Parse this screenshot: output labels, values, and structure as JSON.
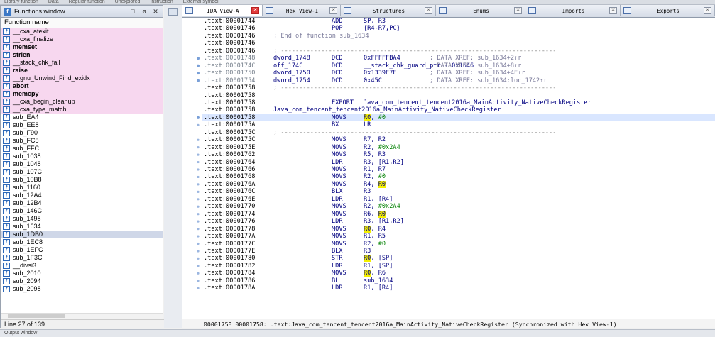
{
  "top_menu": [
    "Library function",
    "Data",
    "Regular function",
    "Unexplored",
    "Instruction",
    "External symbol"
  ],
  "functions_window": {
    "title": "Functions window",
    "column_header": "Function name",
    "status": "Line 27 of 139",
    "items": [
      {
        "name": "__cxa_atexit",
        "kind": "lib",
        "bold": false
      },
      {
        "name": "__cxa_finalize",
        "kind": "lib",
        "bold": false
      },
      {
        "name": "memset",
        "kind": "lib",
        "bold": true
      },
      {
        "name": "strlen",
        "kind": "lib",
        "bold": true
      },
      {
        "name": "__stack_chk_fail",
        "kind": "lib",
        "bold": false
      },
      {
        "name": "raise",
        "kind": "lib",
        "bold": true
      },
      {
        "name": "__gnu_Unwind_Find_exidx",
        "kind": "lib",
        "bold": false
      },
      {
        "name": "abort",
        "kind": "lib",
        "bold": true
      },
      {
        "name": "memcpy",
        "kind": "lib",
        "bold": true
      },
      {
        "name": "__cxa_begin_cleanup",
        "kind": "lib",
        "bold": false
      },
      {
        "name": "__cxa_type_match",
        "kind": "lib",
        "bold": false
      },
      {
        "name": "sub_EA4",
        "kind": "reg",
        "bold": false
      },
      {
        "name": "sub_EE8",
        "kind": "reg",
        "bold": false
      },
      {
        "name": "sub_F90",
        "kind": "reg",
        "bold": false
      },
      {
        "name": "sub_FC8",
        "kind": "reg",
        "bold": false
      },
      {
        "name": "sub_FFC",
        "kind": "reg",
        "bold": false
      },
      {
        "name": "sub_1038",
        "kind": "reg",
        "bold": false
      },
      {
        "name": "sub_1048",
        "kind": "reg",
        "bold": false
      },
      {
        "name": "sub_107C",
        "kind": "reg",
        "bold": false
      },
      {
        "name": "sub_10B8",
        "kind": "reg",
        "bold": false
      },
      {
        "name": "sub_1160",
        "kind": "reg",
        "bold": false
      },
      {
        "name": "sub_12A4",
        "kind": "reg",
        "bold": false
      },
      {
        "name": "sub_12B4",
        "kind": "reg",
        "bold": false
      },
      {
        "name": "sub_146C",
        "kind": "reg",
        "bold": false
      },
      {
        "name": "sub_1498",
        "kind": "reg",
        "bold": false
      },
      {
        "name": "sub_1634",
        "kind": "reg",
        "bold": false
      },
      {
        "name": "sub_1DB0",
        "kind": "sel",
        "bold": false
      },
      {
        "name": "sub_1EC8",
        "kind": "reg",
        "bold": false
      },
      {
        "name": "sub_1EFC",
        "kind": "reg",
        "bold": false
      },
      {
        "name": "sub_1F3C",
        "kind": "reg",
        "bold": false
      },
      {
        "name": "__divsi3",
        "kind": "reg",
        "bold": false
      },
      {
        "name": "sub_2010",
        "kind": "reg",
        "bold": false
      },
      {
        "name": "sub_2094",
        "kind": "reg",
        "bold": false
      },
      {
        "name": "sub_2098",
        "kind": "reg",
        "bold": false
      }
    ]
  },
  "tabs": [
    {
      "label": "IDA View-A",
      "active": true
    },
    {
      "label": "Hex View-1",
      "active": false
    },
    {
      "label": "Structures",
      "active": false
    },
    {
      "label": "Enums",
      "active": false
    },
    {
      "label": "Imports",
      "active": false
    },
    {
      "label": "Exports",
      "active": false
    }
  ],
  "disasm_lines": [
    {
      "addr": ".text:00001744",
      "label": "",
      "mn": "ADD",
      "op": "SP, R3",
      "cmt": "",
      "style": "code"
    },
    {
      "addr": ".text:00001746",
      "label": "",
      "mn": "POP",
      "op": "{R4-R7,PC}",
      "cmt": "",
      "style": "code"
    },
    {
      "addr": ".text:00001746",
      "label": "",
      "mn": "",
      "op": "",
      "cmt": "; End of function sub_1634",
      "style": "endfn"
    },
    {
      "addr": ".text:00001746",
      "label": "",
      "mn": "",
      "op": "",
      "cmt": "",
      "style": "code"
    },
    {
      "addr": ".text:00001746",
      "label": "",
      "mn": "",
      "op": "",
      "cmt": "",
      "style": "sep"
    },
    {
      "addr": ".text:00001748",
      "label": "dword_1748",
      "mn": "DCD",
      "op": "0xFFFFFBA4",
      "cmt": "; DATA XREF: sub_1634+2↑r",
      "style": "data"
    },
    {
      "addr": ".text:0000174C",
      "label": "off_174C",
      "mn": "DCD",
      "op": "__stack_chk_guard_ptr - 0x1646",
      "cmt": "; DATA XREF: sub_1634+8↑r",
      "style": "data"
    },
    {
      "addr": ".text:00001750",
      "label": "dword_1750",
      "mn": "DCD",
      "op": "0x1339E7E",
      "cmt": "; DATA XREF: sub_1634+4E↑r",
      "style": "data"
    },
    {
      "addr": ".text:00001754",
      "label": "dword_1754",
      "mn": "DCD",
      "op": "0x45C",
      "cmt": "; DATA XREF: sub_1634:loc_1742↑r",
      "style": "data"
    },
    {
      "addr": ".text:00001758",
      "label": "",
      "mn": "",
      "op": "",
      "cmt": "",
      "style": "sep"
    },
    {
      "addr": ".text:00001758",
      "label": "",
      "mn": "",
      "op": "",
      "cmt": "",
      "style": "code"
    },
    {
      "addr": ".text:00001758",
      "label": "",
      "mn": "EXPORT",
      "op": "Java_com_tencent_tencent2016a_MainActivity_NativeCheckRegister",
      "cmt": "",
      "style": "export"
    },
    {
      "addr": ".text:00001758",
      "label": "Java_com_tencent_tencent2016a_MainActivity_NativeCheckRegister",
      "mn": "",
      "op": "",
      "cmt": "",
      "style": "fnlabel"
    },
    {
      "addr": ".text:00001758",
      "label": "",
      "mn": "MOVS",
      "op": "R0, #0",
      "cmt": "",
      "style": "cur"
    },
    {
      "addr": ".text:0000175A",
      "label": "",
      "mn": "BX",
      "op": "LR",
      "cmt": "",
      "style": "code"
    },
    {
      "addr": ".text:0000175C",
      "label": "",
      "mn": "",
      "op": "",
      "cmt": "",
      "style": "sep"
    },
    {
      "addr": ".text:0000175C",
      "label": "",
      "mn": "MOVS",
      "op": "R7, R2",
      "cmt": "",
      "style": "code"
    },
    {
      "addr": ".text:0000175E",
      "label": "",
      "mn": "MOVS",
      "op": "R2, #0x2A4",
      "cmt": "",
      "style": "code"
    },
    {
      "addr": ".text:00001762",
      "label": "",
      "mn": "MOVS",
      "op": "R5, R3",
      "cmt": "",
      "style": "code"
    },
    {
      "addr": ".text:00001764",
      "label": "",
      "mn": "LDR",
      "op": "R3, [R1,R2]",
      "cmt": "",
      "style": "code"
    },
    {
      "addr": ".text:00001766",
      "label": "",
      "mn": "MOVS",
      "op": "R1, R7",
      "cmt": "",
      "style": "code"
    },
    {
      "addr": ".text:00001768",
      "label": "",
      "mn": "MOVS",
      "op": "R2, #0",
      "cmt": "",
      "style": "code"
    },
    {
      "addr": ".text:0000176A",
      "label": "",
      "mn": "MOVS",
      "op": "R4, R0",
      "cmt": "",
      "style": "code"
    },
    {
      "addr": ".text:0000176C",
      "label": "",
      "mn": "BLX",
      "op": "R3",
      "cmt": "",
      "style": "code"
    },
    {
      "addr": ".text:0000176E",
      "label": "",
      "mn": "LDR",
      "op": "R1, [R4]",
      "cmt": "",
      "style": "code"
    },
    {
      "addr": ".text:00001770",
      "label": "",
      "mn": "MOVS",
      "op": "R2, #0x2A4",
      "cmt": "",
      "style": "code"
    },
    {
      "addr": ".text:00001774",
      "label": "",
      "mn": "MOVS",
      "op": "R6, R0",
      "cmt": "",
      "style": "code"
    },
    {
      "addr": ".text:00001776",
      "label": "",
      "mn": "LDR",
      "op": "R3, [R1,R2]",
      "cmt": "",
      "style": "code"
    },
    {
      "addr": ".text:00001778",
      "label": "",
      "mn": "MOVS",
      "op": "R0, R4",
      "cmt": "",
      "style": "code"
    },
    {
      "addr": ".text:0000177A",
      "label": "",
      "mn": "MOVS",
      "op": "R1, R5",
      "cmt": "",
      "style": "code"
    },
    {
      "addr": ".text:0000177C",
      "label": "",
      "mn": "MOVS",
      "op": "R2, #0",
      "cmt": "",
      "style": "code"
    },
    {
      "addr": ".text:0000177E",
      "label": "",
      "mn": "BLX",
      "op": "R3",
      "cmt": "",
      "style": "code"
    },
    {
      "addr": ".text:00001780",
      "label": "",
      "mn": "STR",
      "op": "R0, [SP]",
      "cmt": "",
      "style": "code"
    },
    {
      "addr": ".text:00001782",
      "label": "",
      "mn": "LDR",
      "op": "R1, [SP]",
      "cmt": "",
      "style": "code"
    },
    {
      "addr": ".text:00001784",
      "label": "",
      "mn": "MOVS",
      "op": "R0, R6",
      "cmt": "",
      "style": "code"
    },
    {
      "addr": ".text:00001786",
      "label": "",
      "mn": "BL",
      "op": "sub_1634",
      "cmt": "",
      "style": "code"
    },
    {
      "addr": ".text:0000178A",
      "label": "",
      "mn": "LDR",
      "op": "R1, [R4]",
      "cmt": "",
      "style": "code"
    }
  ],
  "separator": "; ---------------------------------------------------------------------------",
  "disasm_status": "00001758 00001758: .text:Java_com_tencent_tencent2016a_MainActivity_NativeCheckRegister (Synchronized with Hex View-1)",
  "bottom_tab": "Output window"
}
